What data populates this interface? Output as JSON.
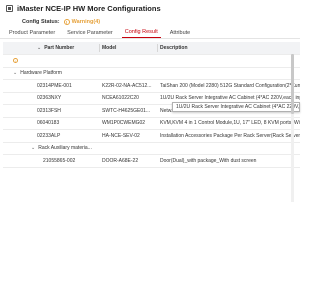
{
  "window": {
    "title": "iMaster NCE-IP HW More Configurations"
  },
  "status": {
    "label": "Config Status:",
    "value": "Warning(4)"
  },
  "tabs": [
    {
      "label": "Product Parameter"
    },
    {
      "label": "Service Parameter"
    },
    {
      "label": "Config Result"
    },
    {
      "label": "Attribute"
    }
  ],
  "table": {
    "headers": {
      "part": "Part Number",
      "model": "Model",
      "desc": "Description"
    },
    "groups": {
      "hardware": "Hardware Platform",
      "rack": "Rack Auxiliary materia..."
    },
    "rows": [
      {
        "part": "02314PME-001",
        "model": "K22R-02-NA-AC512...",
        "desc": "TaiShan 200 (Model 2280) 512G Standard Configuration(2*Kunp..."
      },
      {
        "part": "02363NXY",
        "model": "NCEA61022C20",
        "desc": "1U/2U Rack Server Integrative AC Cabinet (4*AC 220V,each inp..."
      },
      {
        "part": "02313FSH",
        "model": "SWTC-H4625GE01...",
        "desc": "Netw..."
      },
      {
        "part": "06040183",
        "model": "WM1P0CWEMG02",
        "desc": "KVM,KVM 4 in 1 Control Module,1U, 17\" LED, 8 KVM ports, With..."
      },
      {
        "part": "02233ALP",
        "model": "HA-NCE-SEV-02",
        "desc": "Installation Accessories Package Per Rack Server(Rack Server 1..."
      },
      {
        "part": "21055865-002",
        "model": "DOOR-A68E-22",
        "desc": "Door(Dual)_with package_With dust screen"
      }
    ],
    "tooltip": "1U/2U Rack Server Integrative AC Cabinet (4*AC 220V,each i..."
  }
}
